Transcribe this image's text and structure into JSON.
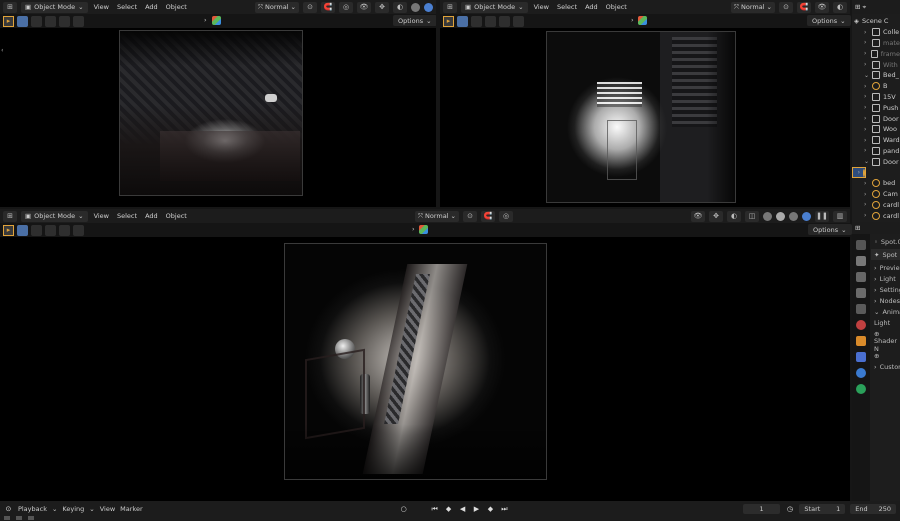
{
  "viewport_top_left": {
    "mode": "Object Mode",
    "menus": [
      "View",
      "Select",
      "Add",
      "Object"
    ],
    "transform_orientation": "Normal",
    "options_label": "Options"
  },
  "viewport_top_right": {
    "mode": "Object Mode",
    "menus": [
      "View",
      "Select",
      "Add",
      "Object"
    ],
    "transform_orientation": "Normal",
    "options_label": "Options"
  },
  "viewport_bottom": {
    "mode": "Object Mode",
    "menus": [
      "View",
      "Select",
      "Add",
      "Object"
    ],
    "transform_orientation": "Normal",
    "options_label": "Options"
  },
  "outliner": {
    "title": "Scene C",
    "items": [
      {
        "label": "Colle",
        "icon": "collection-icon",
        "expanded": false,
        "dim": false
      },
      {
        "label": "mate",
        "icon": "collection-icon",
        "expanded": false,
        "dim": true
      },
      {
        "label": "frame",
        "icon": "collection-icon",
        "expanded": false,
        "dim": true
      },
      {
        "label": "With",
        "icon": "collection-icon",
        "expanded": false,
        "dim": true
      },
      {
        "label": "Bed_",
        "icon": "collection-icon",
        "expanded": true,
        "dim": false
      },
      {
        "label": "B",
        "icon": "object-icon",
        "expanded": false,
        "dim": false
      },
      {
        "label": "15V",
        "icon": "collection-icon",
        "expanded": false,
        "dim": false
      },
      {
        "label": "Push",
        "icon": "collection-icon",
        "expanded": false,
        "dim": false
      },
      {
        "label": "Door",
        "icon": "collection-icon",
        "expanded": false,
        "dim": false
      },
      {
        "label": "Woo",
        "icon": "collection-icon",
        "expanded": false,
        "dim": false
      },
      {
        "label": "Ward",
        "icon": "collection-icon",
        "expanded": false,
        "dim": false
      },
      {
        "label": "pand",
        "icon": "collection-icon",
        "expanded": false,
        "dim": false
      },
      {
        "label": "Door",
        "icon": "collection-icon",
        "expanded": true,
        "dim": false
      },
      {
        "label": "S",
        "icon": "light-icon",
        "expanded": false,
        "dim": false,
        "selected": true
      },
      {
        "label": "bed",
        "icon": "object-icon",
        "expanded": false,
        "dim": false
      },
      {
        "label": "Cam",
        "icon": "camera-icon",
        "expanded": false,
        "dim": false
      },
      {
        "label": "cardl",
        "icon": "object-icon",
        "expanded": false,
        "dim": false
      },
      {
        "label": "cardl",
        "icon": "object-icon",
        "expanded": false,
        "dim": false
      }
    ]
  },
  "properties": {
    "object_name": "Spot.0",
    "data_name": "Spot",
    "sections": [
      "Preview",
      "Light",
      "Settings",
      "Nodes",
      "Animatio"
    ],
    "light_label": "Light",
    "shader_label": "Shader N",
    "custom_label": "Custom"
  },
  "timeline": {
    "menus": [
      "Playback",
      "Keying",
      "View",
      "Marker"
    ],
    "current_frame": "1",
    "start_label": "Start",
    "start_value": "1",
    "end_label": "End",
    "end_value": "250"
  },
  "colors": {
    "accent_blue": "#4a7fd0",
    "selection_orange": "#e0a33a",
    "selected_row": "#2d4c7d"
  }
}
